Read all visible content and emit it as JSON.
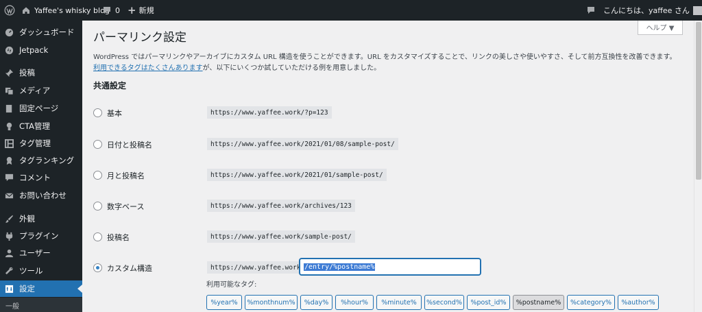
{
  "adminbar": {
    "site_name": "Yaffee's whisky blog",
    "comments_count": "0",
    "new_label": "新規",
    "greeting": "こんにちは、yaffee さん"
  },
  "sidebar": {
    "items": [
      {
        "label": "ダッシュボード",
        "icon": "dashboard-icon"
      },
      {
        "label": "Jetpack",
        "icon": "jetpack-icon"
      },
      {
        "label": "投稿",
        "icon": "pin-icon"
      },
      {
        "label": "メディア",
        "icon": "media-icon"
      },
      {
        "label": "固定ページ",
        "icon": "page-icon"
      },
      {
        "label": "CTA管理",
        "icon": "lightbulb-icon"
      },
      {
        "label": "タグ管理",
        "icon": "tag-manager-icon"
      },
      {
        "label": "タグランキング",
        "icon": "ranking-icon"
      },
      {
        "label": "コメント",
        "icon": "comment-icon"
      },
      {
        "label": "お問い合わせ",
        "icon": "mail-icon"
      },
      {
        "label": "外観",
        "icon": "brush-icon"
      },
      {
        "label": "プラグイン",
        "icon": "plugin-icon"
      },
      {
        "label": "ユーザー",
        "icon": "user-icon"
      },
      {
        "label": "ツール",
        "icon": "wrench-icon"
      },
      {
        "label": "設定",
        "icon": "settings-icon"
      }
    ],
    "submenu_first": "一般"
  },
  "main": {
    "title": "パーマリンク設定",
    "help_label": "ヘルプ ▼",
    "intro_text": "WordPress ではパーマリンクやアーカイブにカスタム URL 構造を使うことができます。URL をカスタマイズすることで、リンクの美しさや使いやすさ、そして前方互換性を改善できます。",
    "intro_link": "利用できるタグはたくさんあります",
    "intro_suffix": "が、以下にいくつか試していただける例を用意しました。",
    "section_heading": "共通設定",
    "options": [
      {
        "label": "基本",
        "example": "https://www.yaffee.work/?p=123",
        "checked": false
      },
      {
        "label": "日付と投稿名",
        "example": "https://www.yaffee.work/2021/01/08/sample-post/",
        "checked": false
      },
      {
        "label": "月と投稿名",
        "example": "https://www.yaffee.work/2021/01/sample-post/",
        "checked": false
      },
      {
        "label": "数字ベース",
        "example": "https://www.yaffee.work/archives/123",
        "checked": false
      },
      {
        "label": "投稿名",
        "example": "https://www.yaffee.work/sample-post/",
        "checked": false
      },
      {
        "label": "カスタム構造",
        "example": "https://www.yaffee.work",
        "checked": true
      }
    ],
    "custom_structure_value": "/entry/%postname%",
    "tags_label": "利用可能なタグ:",
    "tags": [
      "%year%",
      "%monthnum%",
      "%day%",
      "%hour%",
      "%minute%",
      "%second%",
      "%post_id%",
      "%postname%",
      "%category%",
      "%author%"
    ],
    "active_tag": "%postname%"
  },
  "colors": {
    "adminbar_bg": "#1d2327",
    "accent": "#2271b1",
    "content_bg": "#f0f0f1"
  }
}
